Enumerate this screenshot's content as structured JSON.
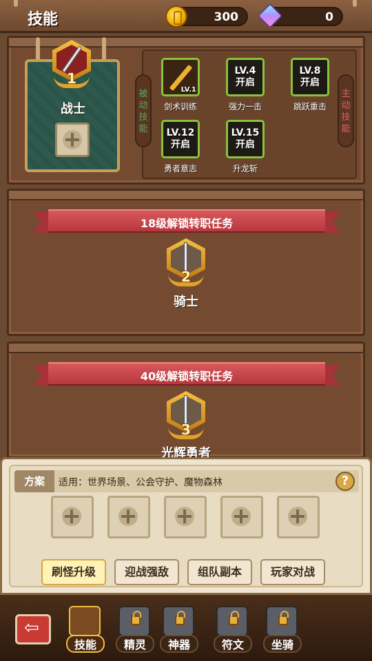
{
  "header": {
    "title": "技能",
    "gold": "300",
    "gems": "0"
  },
  "current_class": {
    "rank": "1",
    "name": "战士"
  },
  "passive_tag": "被动技能",
  "active_tag": "主动技能",
  "skills": [
    {
      "lock": "",
      "level_badge": "LV.1",
      "name": "剑术训练"
    },
    {
      "lock": "LV.4\n开启",
      "name": "强力一击"
    },
    {
      "lock": "LV.8\n开启",
      "name": "跳跃重击"
    },
    {
      "lock": "LV.12\n开启",
      "name": "勇者意志"
    },
    {
      "lock": "LV.15\n开启",
      "name": "升龙斩"
    }
  ],
  "unlocks": [
    {
      "banner": "18级解锁转职任务",
      "rank": "2",
      "name": "骑士"
    },
    {
      "banner": "40级解锁转职任务",
      "rank": "3",
      "name": "光辉勇者"
    }
  ],
  "scheme": {
    "label": "方案",
    "desc": "适用：世界场景、公会守护、魔物森林",
    "help": "?"
  },
  "modes": [
    "刷怪升级",
    "迎战强敌",
    "组队副本",
    "玩家对战"
  ],
  "nav": [
    "技能",
    "精灵",
    "神器",
    "符文",
    "坐骑"
  ],
  "colors": {
    "accent_green": "#8ac23e",
    "ribbon_red": "#c84a50",
    "gold": "#f0c040"
  }
}
